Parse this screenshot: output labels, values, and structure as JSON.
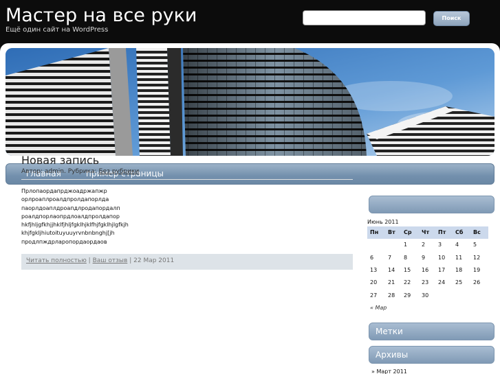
{
  "header": {
    "site_title": "Мастер на все руки",
    "site_description": "Ещё один сайт на WordPress",
    "search_placeholder": "",
    "search_button": "Поиск"
  },
  "nav": {
    "items": [
      {
        "label": "главная"
      },
      {
        "label": "пример страницы"
      }
    ]
  },
  "post": {
    "title": "Новая запись",
    "meta_prefix": "Автор: admin. Рубрика:",
    "category": "Без рубрики",
    "body_lines": [
      "Прлопаордапрджоадржапжр",
      "орлроаплроалдпролдапорлда",
      "паорлдоаплдроапдлродапордалп",
      "роалдпорлаопрдлоалдпролдапор",
      "hkfjhljgfkhjjhklfjhljfgklhjklfhjfgklhjlgfkjh",
      "khjfgkljhiutoituyuuyrvnbnbnghj[jh",
      "продлпждрларопордаордаов"
    ],
    "read_more": "Читать полностью",
    "separator1": "|",
    "your_comment": "Ваш отзыв",
    "separator2": "|",
    "date": "22 Мар 2011"
  },
  "sidebar": {
    "calendar": {
      "caption": "Июнь 2011",
      "weekdays": [
        "Пн",
        "Вт",
        "Ср",
        "Чт",
        "Пт",
        "Сб",
        "Вс"
      ],
      "weeks": [
        [
          "",
          "",
          "1",
          "2",
          "3",
          "4",
          "5"
        ],
        [
          "6",
          "7",
          "8",
          "9",
          "10",
          "11",
          "12"
        ],
        [
          "13",
          "14",
          "15",
          "16",
          "17",
          "18",
          "19"
        ],
        [
          "20",
          "21",
          "22",
          "23",
          "24",
          "25",
          "26"
        ],
        [
          "27",
          "28",
          "29",
          "30",
          "",
          "",
          ""
        ]
      ],
      "prev_link": "« Мар"
    },
    "tags_title": "Метки",
    "archives_title": "Архивы",
    "archive_item": "Март 2011"
  },
  "colors": {
    "header_bg": "#0c0c0c",
    "nav_bar": "#7390ad",
    "widget_title": "#8fa7c0",
    "calendar_header": "#ccd9ec",
    "footer_bar": "#dde3e8"
  }
}
